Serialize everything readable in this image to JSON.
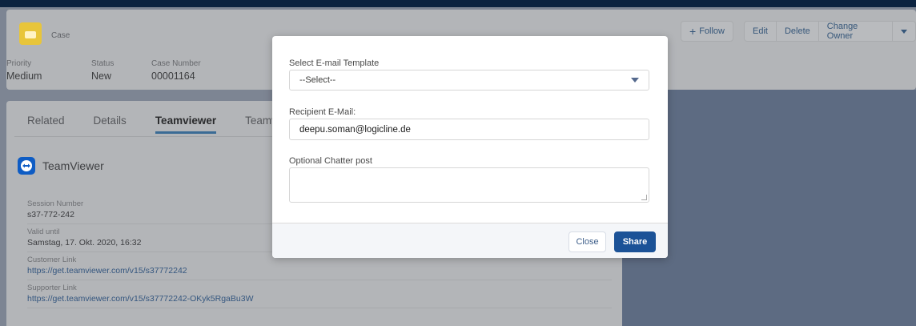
{
  "header": {
    "object_label": "Case",
    "actions": {
      "follow_label": "Follow",
      "edit_label": "Edit",
      "delete_label": "Delete",
      "change_owner_label": "Change Owner"
    },
    "fields": [
      {
        "label": "Priority",
        "value": "Medium"
      },
      {
        "label": "Status",
        "value": "New"
      },
      {
        "label": "Case Number",
        "value": "00001164"
      }
    ]
  },
  "tabs": [
    "Related",
    "Details",
    "Teamviewer",
    "Teamvi"
  ],
  "active_tab": "Teamviewer",
  "teamviewer": {
    "title": "TeamViewer",
    "items": [
      {
        "label": "Session Number",
        "value": "s37-772-242"
      },
      {
        "label": "Valid until",
        "value": "Samstag, 17. Okt. 2020, 16:32"
      },
      {
        "label": "Customer Link",
        "value": "https://get.teamviewer.com/v15/s37772242"
      },
      {
        "label": "Supporter Link",
        "value": "https://get.teamviewer.com/v15/s37772242-OKyk5RgaBu3W"
      }
    ]
  },
  "modal": {
    "template_label": "Select E-mail Template",
    "template_value": "--Select--",
    "recipient_label": "Recipient E-Mail:",
    "recipient_value": "deepu.soman@logicline.de",
    "chatter_label": "Optional Chatter post",
    "chatter_value": "",
    "close_label": "Close",
    "share_label": "Share"
  },
  "colors": {
    "brand": "#1b5297",
    "overlay": "#7d8593"
  }
}
